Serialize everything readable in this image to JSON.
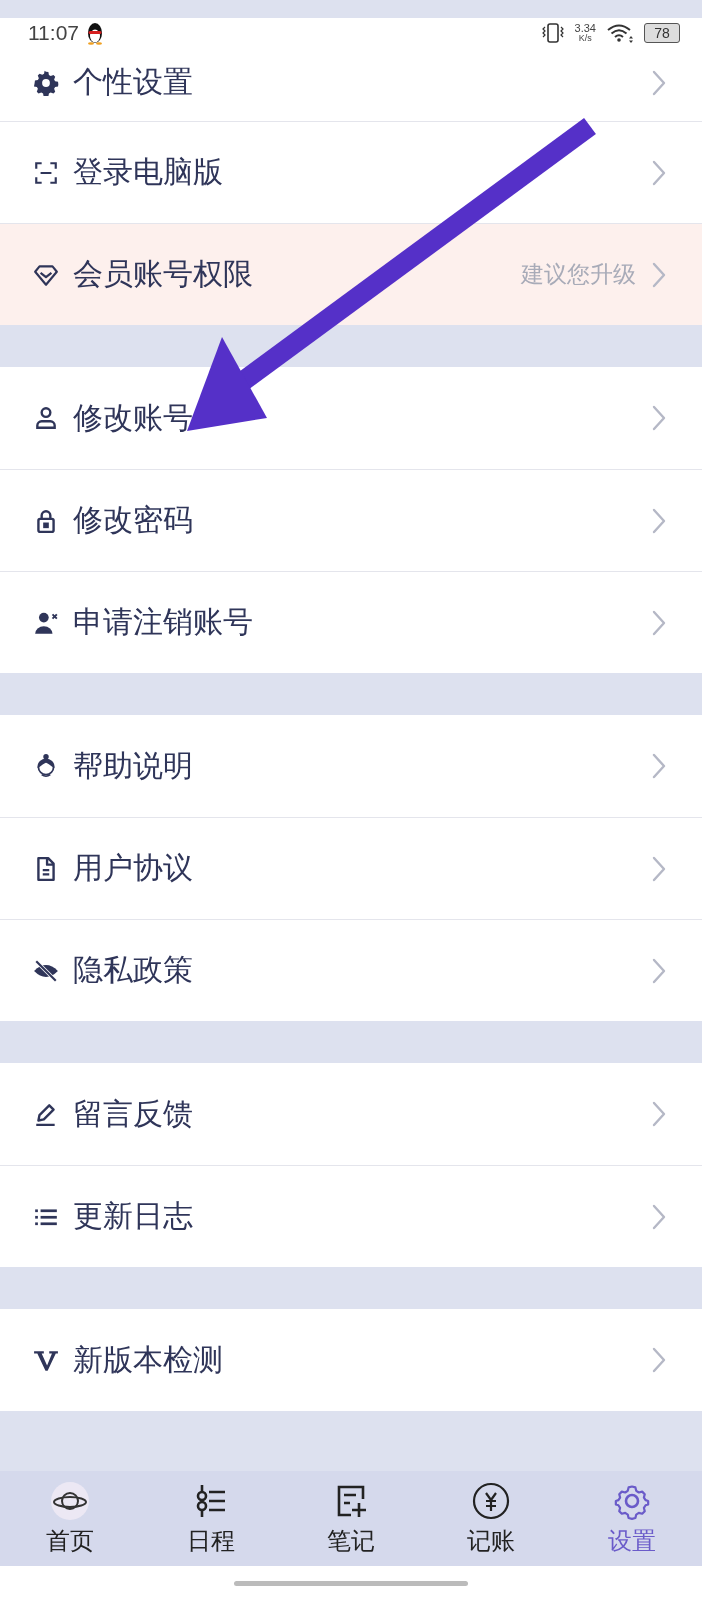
{
  "status_bar": {
    "time": "11:07",
    "speed": "3.34",
    "speed_unit": "K/s",
    "battery": "78"
  },
  "sections": [
    [
      {
        "label": "个性设置",
        "highlighted": false
      },
      {
        "label": "登录电脑版",
        "highlighted": false
      },
      {
        "label": "会员账号权限",
        "hint": "建议您升级",
        "highlighted": true
      }
    ],
    [
      {
        "label": "修改账号",
        "highlighted": false
      },
      {
        "label": "修改密码",
        "highlighted": false
      },
      {
        "label": "申请注销账号",
        "highlighted": false
      }
    ],
    [
      {
        "label": "帮助说明",
        "highlighted": false
      },
      {
        "label": "用户协议",
        "highlighted": false
      },
      {
        "label": "隐私政策",
        "highlighted": false
      }
    ],
    [
      {
        "label": "留言反馈",
        "highlighted": false
      },
      {
        "label": "更新日志",
        "highlighted": false
      }
    ],
    [
      {
        "label": "新版本检测",
        "highlighted": false
      }
    ]
  ],
  "tab_bar": [
    {
      "label": "首页",
      "selected": false
    },
    {
      "label": "日程",
      "selected": false
    },
    {
      "label": "笔记",
      "selected": false
    },
    {
      "label": "记账",
      "selected": false
    },
    {
      "label": "设置",
      "selected": true
    }
  ]
}
